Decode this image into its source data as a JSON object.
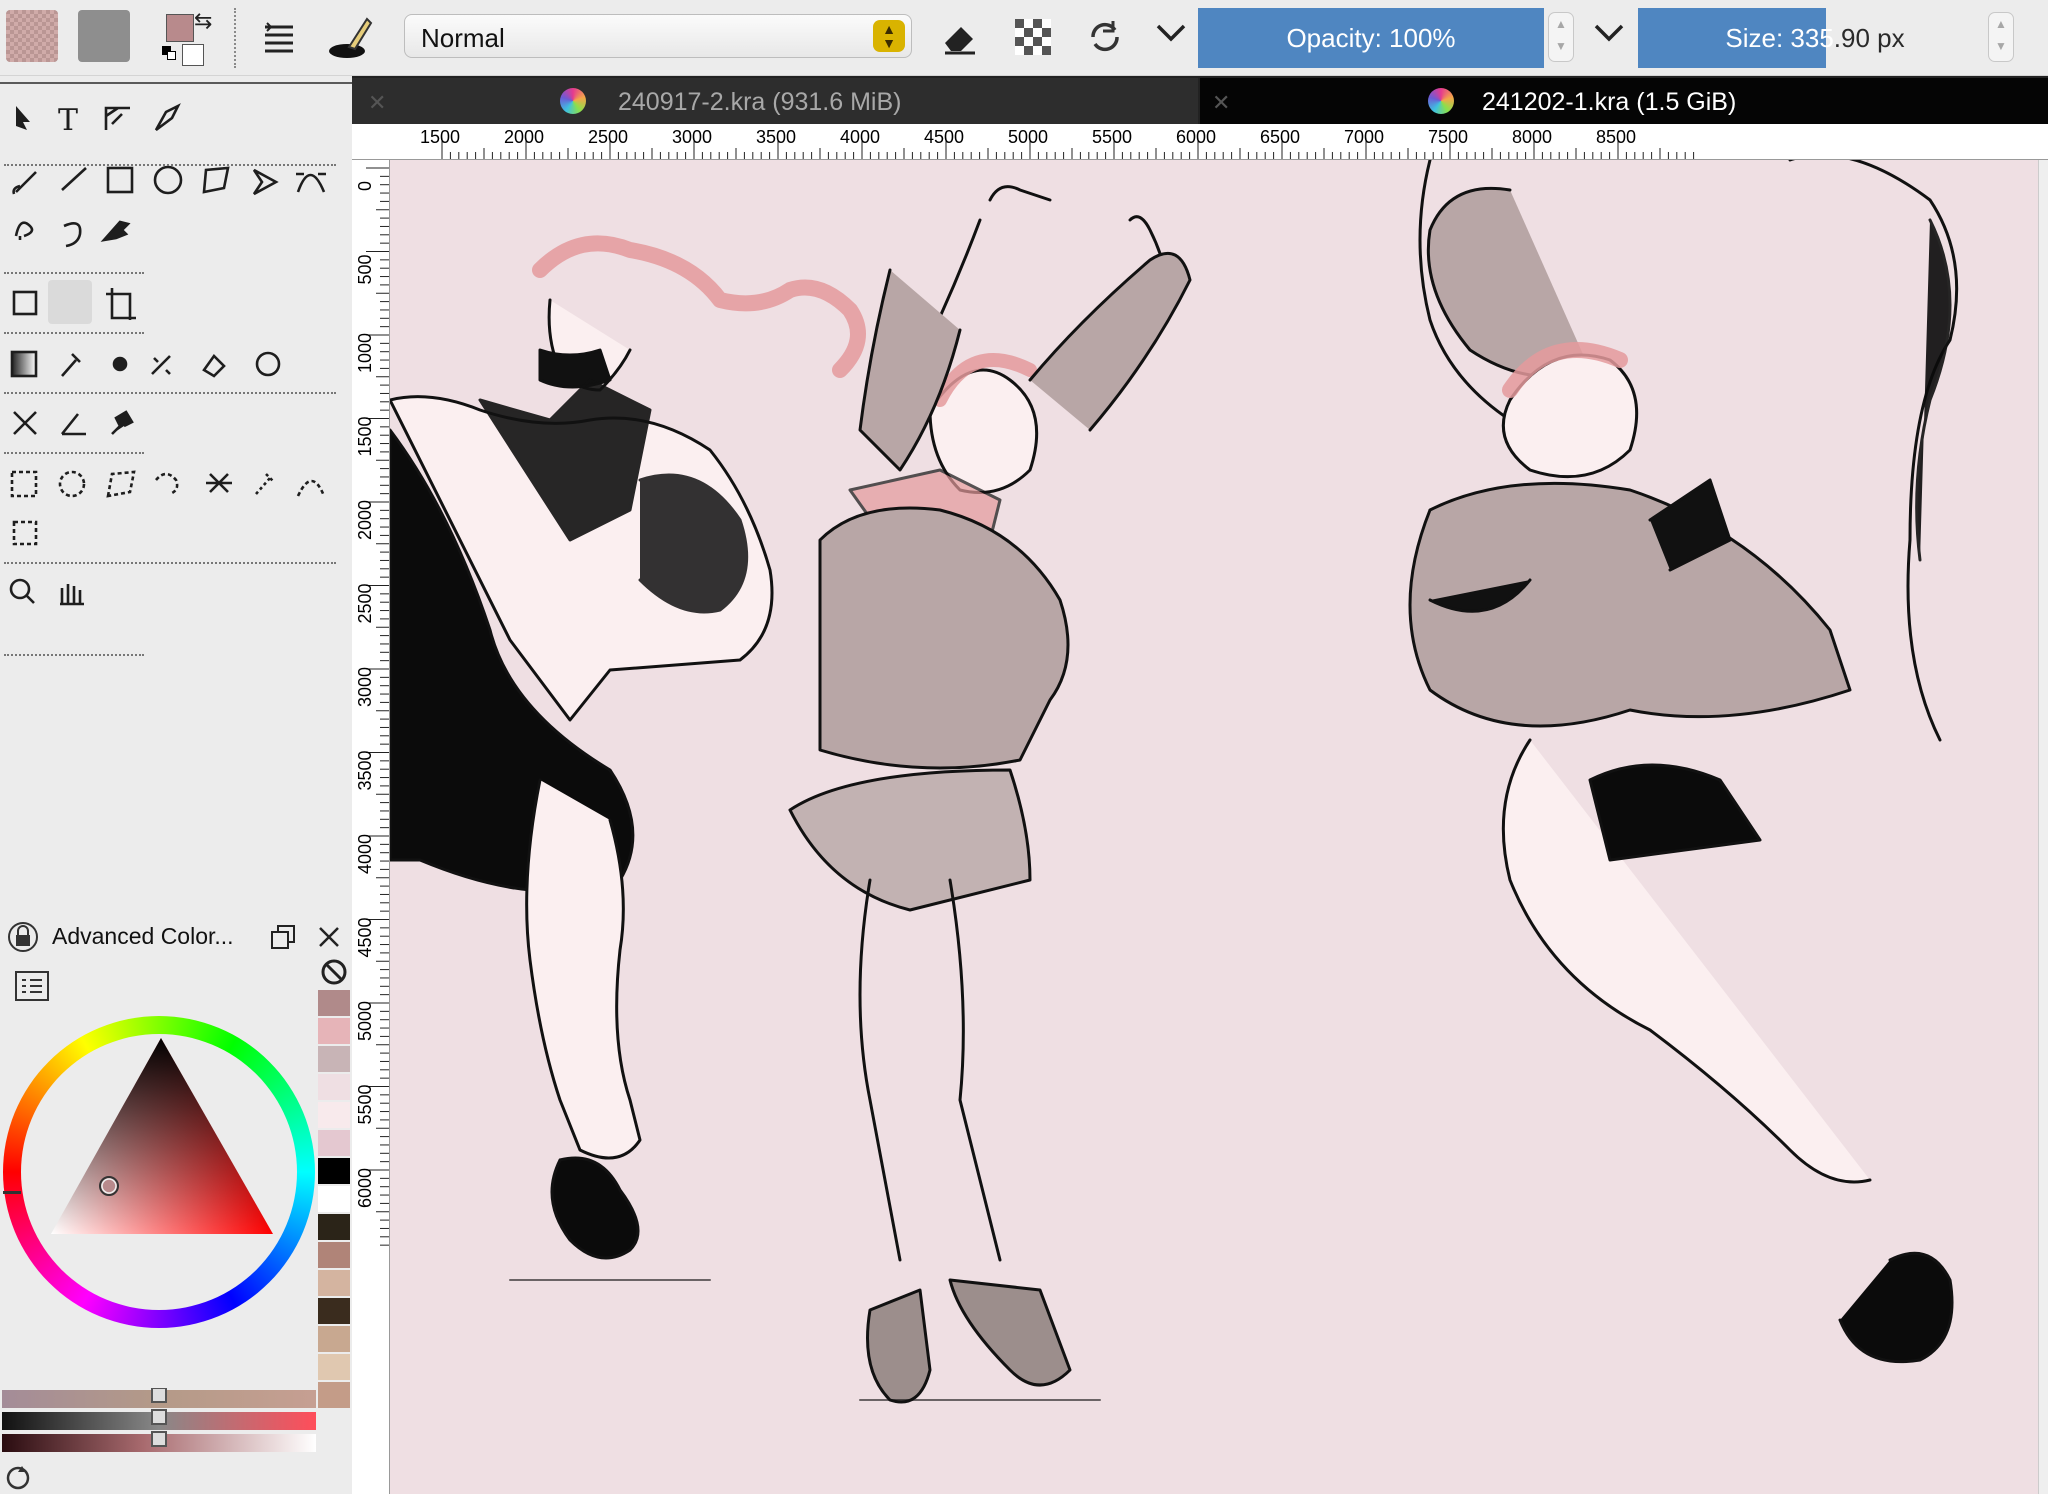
{
  "toolbar": {
    "blend_mode": "Normal",
    "opacity_label": "Opacity: 100%",
    "opacity": 1.0,
    "size_label_main": "Size: 335",
    "size_label_rest": ".90 px",
    "size_fill_fraction": 0.53,
    "foreground_color": "#b88a8c",
    "background_color": "#ffffff",
    "accent_color": "#4f86c1",
    "icons": [
      "brush-preset-icon",
      "layer-list-icon",
      "brush-editor-icon",
      "eraser-icon",
      "alpha-lock-icon",
      "reload-preset-icon",
      "chevron-down-icon"
    ]
  },
  "tabs": [
    {
      "label": "240917-2.kra (931.6 MiB)",
      "active": false
    },
    {
      "label": "241202-1.kra (1.5 GiB)",
      "active": true
    }
  ],
  "rulers": {
    "top": [
      "1500",
      "2000",
      "2500",
      "3000",
      "3500",
      "4000",
      "4500",
      "5000",
      "5500",
      "6000",
      "6500",
      "7000",
      "7500",
      "8000",
      "8500"
    ],
    "left": [
      "0",
      "500",
      "1000",
      "1500",
      "2000",
      "2500",
      "3000",
      "3500",
      "4000",
      "4500",
      "5000",
      "5500",
      "6000"
    ]
  },
  "color_panel": {
    "title": "Advanced Color...",
    "history_colors": [
      "#b08a8a",
      "#e6b4b8",
      "#c8b4b6",
      "#efdfe3",
      "#f8eaec",
      "#e4c8d0",
      "#000000",
      "#ffffff",
      "#2b2418",
      "#b08478",
      "#d4b4a0",
      "#3a2c1e",
      "#c8a890",
      "#e0c8b0",
      "#c49c88"
    ]
  },
  "canvas": {
    "background": "#efdfe3"
  }
}
